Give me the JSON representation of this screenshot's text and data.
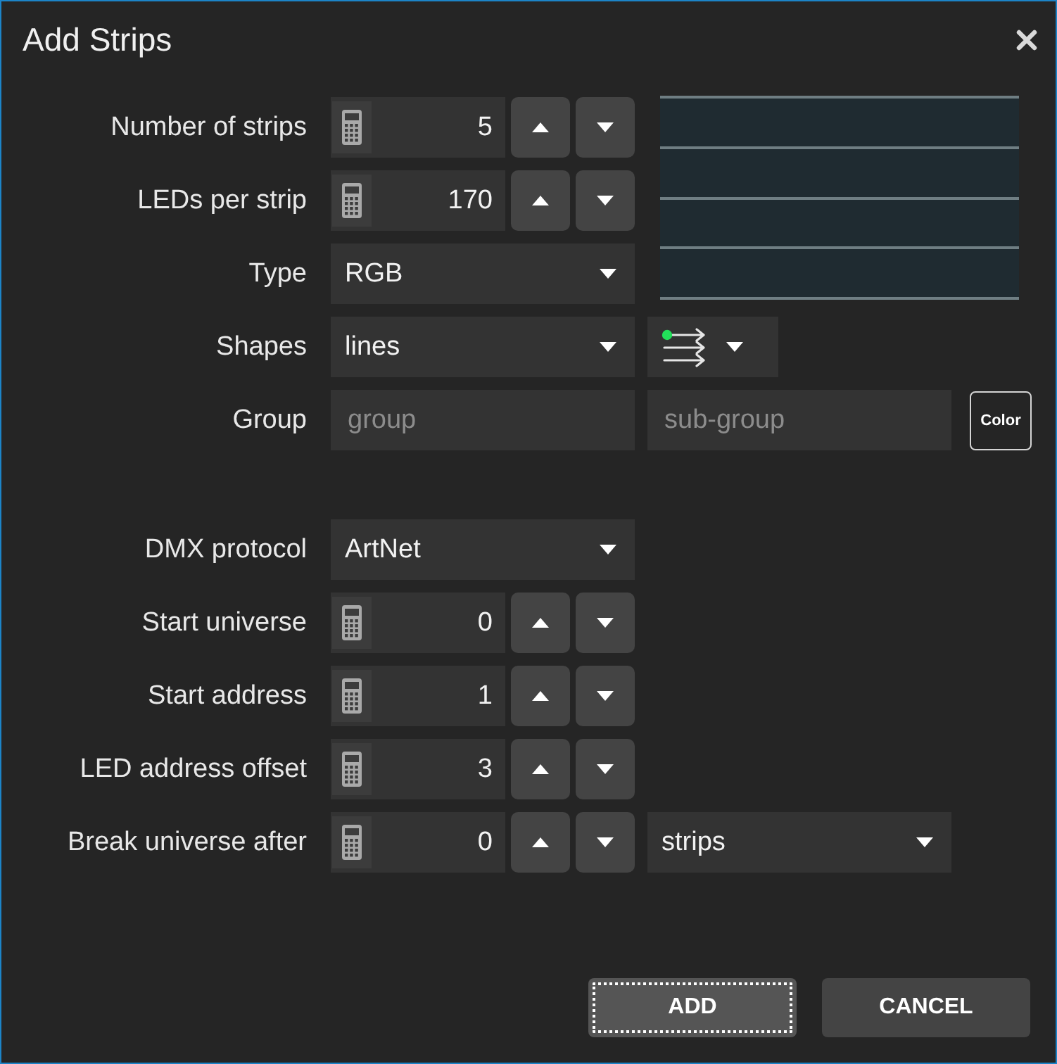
{
  "window": {
    "title": "Add Strips"
  },
  "sections": [
    {
      "rows": [
        {
          "label": "Number of strips",
          "controls": [
            {
              "kind": "number",
              "value": "5"
            }
          ]
        },
        {
          "label": "LEDs per strip",
          "controls": [
            {
              "kind": "number",
              "value": "170"
            }
          ]
        },
        {
          "label": "Type",
          "controls": [
            {
              "kind": "dropdown",
              "value": "RGB"
            }
          ]
        },
        {
          "label": "Shapes",
          "controls": [
            {
              "kind": "dropdown",
              "value": "lines"
            },
            {
              "kind": "icon_dropdown"
            }
          ]
        },
        {
          "label": "Group",
          "controls": [
            {
              "kind": "text",
              "placeholder": "group"
            },
            {
              "kind": "text",
              "placeholder": "sub-group"
            },
            {
              "kind": "button",
              "text": "Color"
            }
          ]
        }
      ]
    },
    {
      "rows": [
        {
          "label": "DMX protocol",
          "controls": [
            {
              "kind": "dropdown",
              "value": "ArtNet"
            }
          ]
        },
        {
          "label": "Start universe",
          "controls": [
            {
              "kind": "number",
              "value": "0"
            }
          ]
        },
        {
          "label": "Start address",
          "controls": [
            {
              "kind": "number",
              "value": "1"
            }
          ]
        },
        {
          "label": "LED address offset",
          "controls": [
            {
              "kind": "number",
              "value": "3"
            }
          ]
        },
        {
          "label": "Break universe after",
          "controls": [
            {
              "kind": "number",
              "value": "0"
            },
            {
              "kind": "dropdown",
              "value": "strips"
            }
          ]
        }
      ]
    }
  ],
  "buttons": [
    {
      "label": "ADD",
      "focused": true
    },
    {
      "label": "CANCEL",
      "focused": false
    }
  ]
}
